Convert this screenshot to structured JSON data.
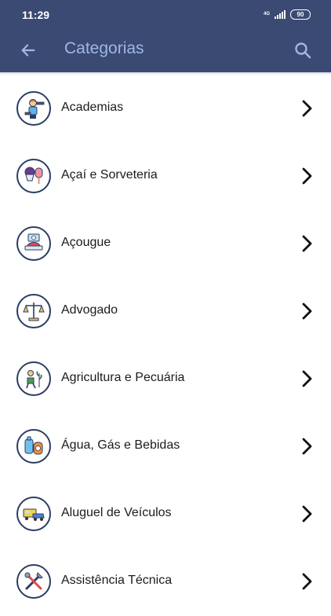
{
  "status_bar": {
    "time": "11:29",
    "network": "4G",
    "battery": "90"
  },
  "app_bar": {
    "title": "Categorias"
  },
  "categories": [
    {
      "label": "Academias",
      "icon": "gym-trainer-icon"
    },
    {
      "label": "Açaí e Sorveteria",
      "icon": "ice-cream-icon"
    },
    {
      "label": "Açougue",
      "icon": "butcher-scale-icon"
    },
    {
      "label": "Advogado",
      "icon": "justice-scale-icon"
    },
    {
      "label": "Agricultura e Pecuária",
      "icon": "farmer-icon"
    },
    {
      "label": "Água, Gás e Bebidas",
      "icon": "water-gas-icon"
    },
    {
      "label": "Aluguel de Veículos",
      "icon": "rental-vehicles-icon"
    },
    {
      "label": "Assistência Técnica",
      "icon": "tools-icon"
    }
  ],
  "colors": {
    "header": "#3a4a72",
    "title": "#9fb6e6",
    "icon_border": "#2b3d64"
  }
}
